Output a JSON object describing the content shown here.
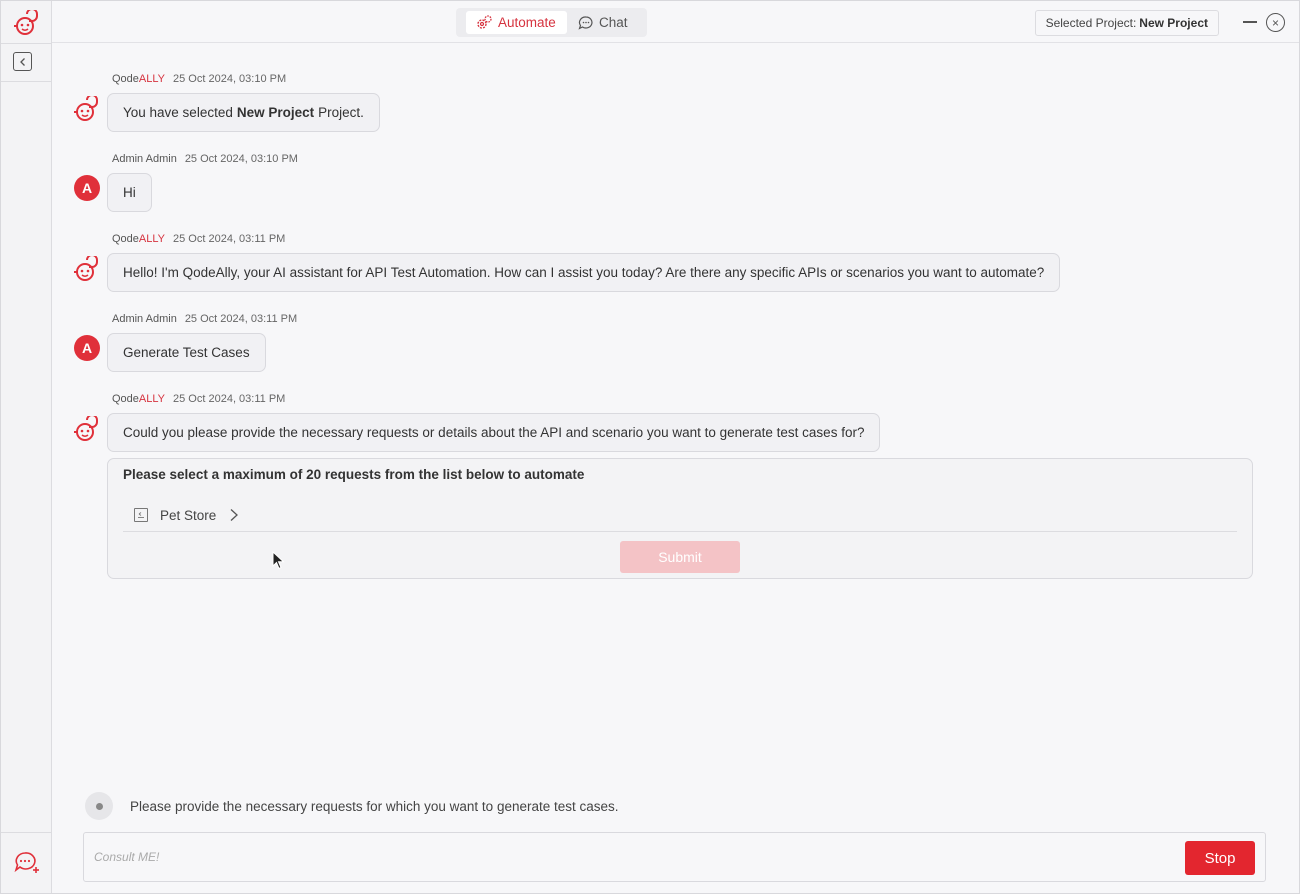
{
  "app": {
    "mode_automate_label": "Automate",
    "mode_chat_label": "Chat",
    "selected_project_prefix": "Selected Project:",
    "selected_project_name": "New Project",
    "accent_color": "#e3262f"
  },
  "messages": [
    {
      "sender_prefix": "Qode",
      "sender_suffix": "ALLY",
      "time": "25 Oct 2024, 03:10 PM",
      "text_before": "You have selected",
      "text_bold": "New Project",
      "text_after": "Project."
    },
    {
      "sender": "Admin Admin",
      "avatar_letter": "A",
      "time": "25 Oct 2024, 03:10 PM",
      "text": "Hi"
    },
    {
      "sender_prefix": "Qode",
      "sender_suffix": "ALLY",
      "time": "25 Oct 2024, 03:11 PM",
      "text": "Hello! I'm QodeAlly, your AI assistant for API Test Automation. How can I assist you today? Are there any specific APIs or scenarios you want to automate?"
    },
    {
      "sender": "Admin Admin",
      "avatar_letter": "A",
      "time": "25 Oct 2024, 03:11 PM",
      "text": "Generate Test Cases"
    },
    {
      "sender_prefix": "Qode",
      "sender_suffix": "ALLY",
      "time": "25 Oct 2024, 03:11 PM",
      "text": "Could you please provide the necessary requests or details about the API and scenario you want to generate test cases for?"
    }
  ],
  "select_panel": {
    "title": "Please select a maximum of 20 requests from the list below to automate",
    "collection_name": "Pet Store",
    "submit_label": "Submit"
  },
  "status": {
    "text": "Please provide the necessary requests for which you want to generate test cases."
  },
  "composer": {
    "placeholder": "Consult ME!",
    "stop_label": "Stop"
  }
}
